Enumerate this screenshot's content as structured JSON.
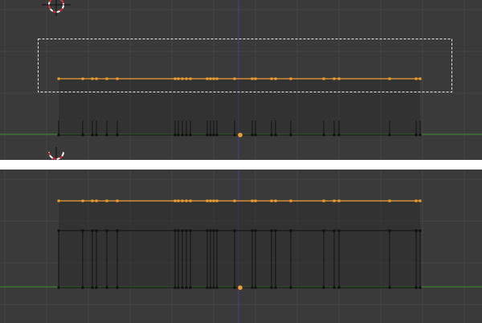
{
  "colors": {
    "background": "#3a3a3a",
    "grid": "#444444",
    "x_axis": "#3d8a2a",
    "z_axis": "#4a3f8f",
    "selected_edge": "#f0a030",
    "unselected_edge": "#111111",
    "face_fill": "#2a2a2a",
    "box_select": "#e8e8e8",
    "origin": "#f0a030",
    "cursor_red": "#d03030",
    "separator": "#ffffff"
  },
  "icons": {
    "top_cursor": "3d-cursor-icon",
    "lower_cursor": "3d-cursor-icon",
    "origin": "object-origin-icon"
  }
}
